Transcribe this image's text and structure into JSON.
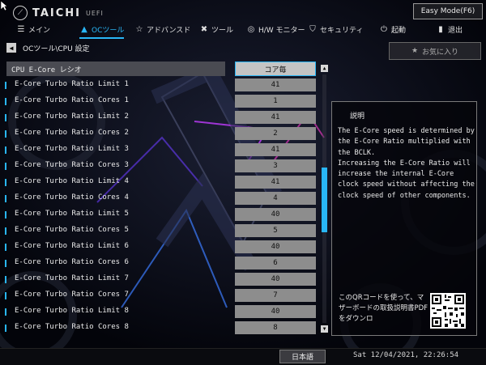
{
  "header": {
    "brand": "TAICHI",
    "brand_suffix": "UEFI",
    "easy_mode_label": "Easy Mode(F6)"
  },
  "nav": {
    "items": [
      {
        "label": "メイン",
        "icon": "list-icon"
      },
      {
        "label": "OCツール",
        "icon": "flame-icon"
      },
      {
        "label": "アドバンスド",
        "icon": "star-icon"
      },
      {
        "label": "ツール",
        "icon": "wrench-icon"
      },
      {
        "label": "H/W モニター",
        "icon": "monitor-icon"
      },
      {
        "label": "セキュリティ",
        "icon": "shield-icon"
      },
      {
        "label": "起動",
        "icon": "power-icon"
      },
      {
        "label": "退出",
        "icon": "exit-icon"
      }
    ]
  },
  "breadcrumb": "OCツール\\CPU 設定",
  "favorite_label": "お気に入り",
  "settings": {
    "header": {
      "label": "CPU E-Core レシオ",
      "value": "コア毎"
    },
    "rows": [
      {
        "label": "E-Core Turbo Ratio Limit 1",
        "value": "41"
      },
      {
        "label": "E-Core Turbo Ratio Cores 1",
        "value": "1"
      },
      {
        "label": "E-Core Turbo Ratio Limit 2",
        "value": "41"
      },
      {
        "label": "E-Core Turbo Ratio Cores 2",
        "value": "2"
      },
      {
        "label": "E-Core Turbo Ratio Limit 3",
        "value": "41"
      },
      {
        "label": "E-Core Turbo Ratio Cores 3",
        "value": "3"
      },
      {
        "label": "E-Core Turbo Ratio Limit 4",
        "value": "41"
      },
      {
        "label": "E-Core Turbo Ratio Cores 4",
        "value": "4"
      },
      {
        "label": "E-Core Turbo Ratio Limit 5",
        "value": "40"
      },
      {
        "label": "E-Core Turbo Ratio Cores 5",
        "value": "5"
      },
      {
        "label": "E-Core Turbo Ratio Limit 6",
        "value": "40"
      },
      {
        "label": "E-Core Turbo Ratio Cores 6",
        "value": "6"
      },
      {
        "label": "E-Core Turbo Ratio Limit 7",
        "value": "40"
      },
      {
        "label": "E-Core Turbo Ratio Cores 7",
        "value": "7"
      },
      {
        "label": "E-Core Turbo Ratio Limit 8",
        "value": "40"
      },
      {
        "label": "E-Core Turbo Ratio Cores 8",
        "value": "8"
      }
    ]
  },
  "description": {
    "title": "説明",
    "body": "The E-Core speed is determined by the E-Core Ratio multiplied with the BCLK.\nIncreasing the E-Core Ratio will increase the internal E-Core clock speed without affecting the clock speed of other components.",
    "qr_text": "このQRコードを使って、マザーボードの取扱説明書PDFをダウンロ"
  },
  "status": {
    "language": "日本語",
    "datetime": "Sat 12/04/2021, 22:26:54"
  },
  "colors": {
    "accent": "#29b6f6",
    "value_bg": "#8d8d8d",
    "background": "#05060a"
  }
}
